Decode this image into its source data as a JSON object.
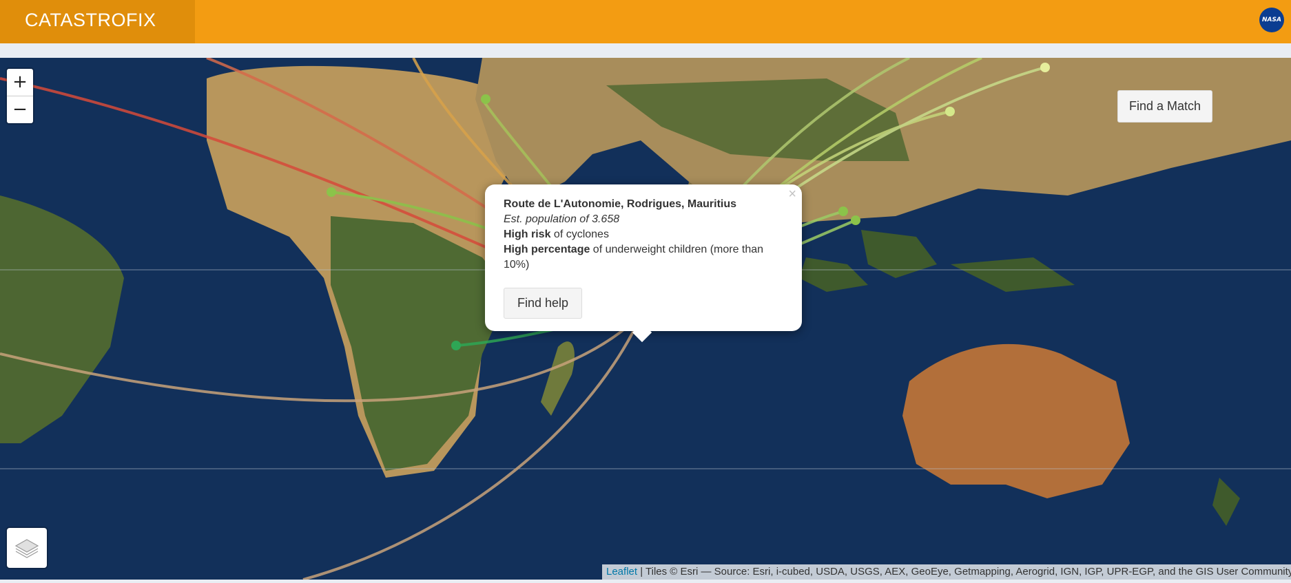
{
  "app": {
    "title": "CATASTROFIX"
  },
  "header": {
    "logo_text": "NASA"
  },
  "map": {
    "zoom_in_label": "+",
    "zoom_out_label": "−",
    "find_match_label": "Find a Match",
    "layers_icon": "layers-icon",
    "marker_icon": "map-marker-icon"
  },
  "popup": {
    "close_label": "×",
    "title": "Route de L'Autonomie, Rodrigues, Mauritius",
    "population": "Est. population of 3.658",
    "risk_strong": "High risk",
    "risk_rest": " of cyclones",
    "underweight_strong": "High percentage",
    "underweight_rest": " of underweight children (more than 10%)",
    "button_label": "Find help"
  },
  "attribution": {
    "link": "Leaflet",
    "text": " | Tiles © Esri — Source: Esri, i-cubed, USDA, USGS, AEX, GeoEye, Getmapping, Aerogrid, IGN, IGP, UPR-EGP, and the GIS User Community"
  },
  "colors": {
    "brand": "#f39c12",
    "brand_dark": "#e08e0b",
    "route_green": "#8bc34a",
    "route_red": "#e53935",
    "route_tan": "#c8a27a",
    "marker": "#2a81cb"
  }
}
